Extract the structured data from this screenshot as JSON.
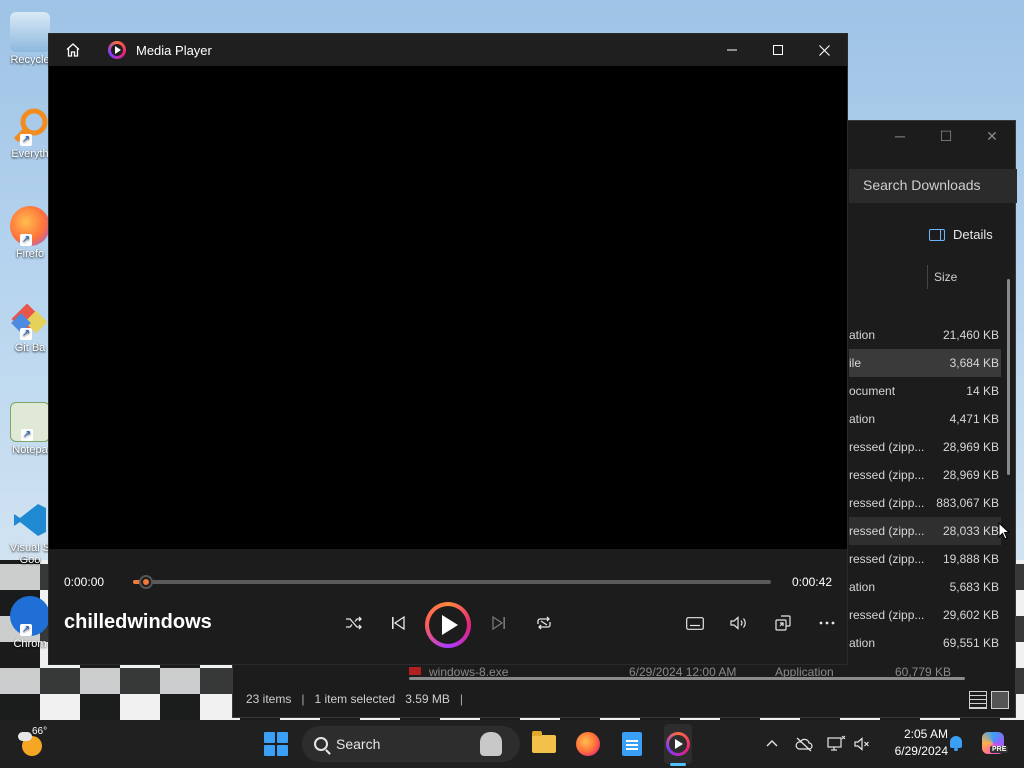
{
  "desktop": {
    "icons": [
      {
        "label": "Recycle",
        "icon": "recycle-bin-icon"
      },
      {
        "label": "Everyth",
        "icon": "everything-search-icon"
      },
      {
        "label": "Firefo",
        "icon": "firefox-icon"
      },
      {
        "label": "Git Ba",
        "icon": "git-bash-icon"
      },
      {
        "label": "Notepa",
        "icon": "notepad-icon"
      },
      {
        "label": "Visual S Goo",
        "icon": "vscode-icon"
      },
      {
        "label": "Chrom",
        "icon": "chrome-icon"
      }
    ]
  },
  "explorer": {
    "search_placeholder": "Search Downloads",
    "details_label": "Details",
    "column_size": "Size",
    "rows": [
      {
        "type": "ation",
        "size": "21,460 KB"
      },
      {
        "type": "ile",
        "size": "3,684 KB",
        "selected": true
      },
      {
        "type": "ocument",
        "size": "14 KB"
      },
      {
        "type": "ation",
        "size": "4,471 KB"
      },
      {
        "type": "ressed (zipp...",
        "size": "28,969 KB"
      },
      {
        "type": "ressed (zipp...",
        "size": "28,969 KB"
      },
      {
        "type": "ressed (zipp...",
        "size": "883,067 KB"
      },
      {
        "type": "ressed (zipp...",
        "size": "28,033 KB",
        "hover": true
      },
      {
        "type": "ressed (zipp...",
        "size": "19,888 KB"
      },
      {
        "type": "ation",
        "size": "5,683 KB"
      },
      {
        "type": "ressed (zipp...",
        "size": "29,602 KB"
      },
      {
        "type": "ation",
        "size": "69,551 KB"
      }
    ],
    "partial_row": {
      "name": "windows-8.exe",
      "date": "6/29/2024 12:00 AM",
      "type": "Application",
      "size": "60,779 KB"
    },
    "status": {
      "items": "23 items",
      "selected": "1 item selected",
      "size": "3.59 MB"
    }
  },
  "player": {
    "app_title": "Media Player",
    "time_current": "0:00:00",
    "time_total": "0:00:42",
    "progress": 0.02,
    "media_title": "chilledwindows",
    "controls": [
      "shuffle-icon",
      "previous-icon",
      "play-icon",
      "next-icon",
      "repeat-icon",
      "captions-icon",
      "volume-icon",
      "miniplayer-icon",
      "more-icon"
    ]
  },
  "taskbar": {
    "weather_temp": "66°",
    "search_label": "Search",
    "clock_time": "2:05 AM",
    "clock_date": "6/29/2024",
    "copilot_badge": "PRE"
  },
  "colors": {
    "accent": "#f07a3a",
    "taskbar": "#202020",
    "player_controls_bg": "#1c1c1c"
  }
}
